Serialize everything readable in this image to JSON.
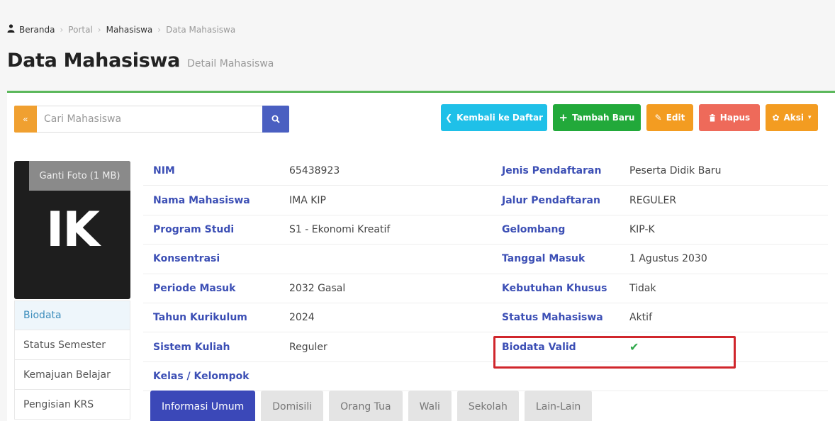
{
  "breadcrumb": {
    "home": "Beranda",
    "portal": "Portal",
    "mahasiswa": "Mahasiswa",
    "current": "Data Mahasiswa"
  },
  "page": {
    "title": "Data Mahasiswa",
    "subtitle": "Detail Mahasiswa"
  },
  "search": {
    "back_label": "«",
    "placeholder": "Cari Mahasiswa",
    "value": ""
  },
  "actions": {
    "back": "Kembali ke Daftar",
    "add": "Tambah Baru",
    "edit": "Edit",
    "delete": "Hapus",
    "more": "Aksi"
  },
  "photo": {
    "change_label": "Ganti Foto (1 MB)",
    "initials": "IK"
  },
  "side_menu": [
    {
      "label": "Biodata",
      "active": true
    },
    {
      "label": "Status Semester",
      "active": false
    },
    {
      "label": "Kemajuan Belajar",
      "active": false
    },
    {
      "label": "Pengisian KRS",
      "active": false
    }
  ],
  "details": {
    "rows": [
      {
        "k1": "NIM",
        "v1": "65438923",
        "k2": "Jenis Pendaftaran",
        "v2": "Peserta Didik Baru"
      },
      {
        "k1": "Nama Mahasiswa",
        "v1": "IMA KIP",
        "k2": "Jalur Pendaftaran",
        "v2": "REGULER"
      },
      {
        "k1": "Program Studi",
        "v1": "S1 - Ekonomi Kreatif",
        "k2": "Gelombang",
        "v2": "KIP-K"
      },
      {
        "k1": "Konsentrasi",
        "v1": "",
        "k2": "Tanggal Masuk",
        "v2": "1 Agustus 2030"
      },
      {
        "k1": "Periode Masuk",
        "v1": "2032 Gasal",
        "k2": "Kebutuhan Khusus",
        "v2": "Tidak"
      },
      {
        "k1": "Tahun Kurikulum",
        "v1": "2024",
        "k2": "Status Mahasiswa",
        "v2": "Aktif"
      },
      {
        "k1": "Sistem Kuliah",
        "v1": "Reguler",
        "k2": "Biodata Valid",
        "v2": "✔"
      },
      {
        "k1": "Kelas / Kelompok",
        "v1": "",
        "k2": "",
        "v2": ""
      }
    ]
  },
  "tabs": [
    {
      "label": "Informasi Umum",
      "active": true
    },
    {
      "label": "Domisili",
      "active": false
    },
    {
      "label": "Orang Tua",
      "active": false
    },
    {
      "label": "Wali",
      "active": false
    },
    {
      "label": "Sekolah",
      "active": false
    },
    {
      "label": "Lain-Lain",
      "active": false
    }
  ],
  "colors": {
    "accent_green": "#5cb85c",
    "primary": "#3b48b8",
    "info": "#1fc0e8",
    "success": "#22a93a",
    "warning": "#f39c21",
    "danger": "#ee6a5a",
    "highlight": "#d0262c"
  }
}
